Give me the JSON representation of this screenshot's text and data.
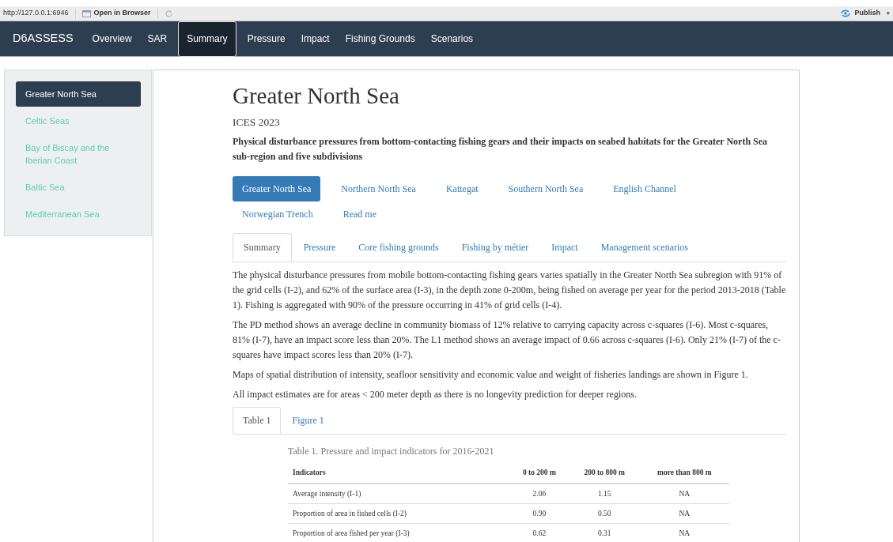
{
  "toolbar": {
    "url": "http://127.0.0.1:6946",
    "open_label": "Open in Browser",
    "publish_label": "Publish",
    "publish_caret": "▾"
  },
  "navbar": {
    "brand": "D6ASSESS",
    "items": [
      {
        "label": "Overview",
        "selected": false
      },
      {
        "label": "SAR",
        "selected": false
      },
      {
        "label": "Summary",
        "selected": true
      },
      {
        "label": "Pressure",
        "selected": false
      },
      {
        "label": "Impact",
        "selected": false
      },
      {
        "label": "Fishing Grounds",
        "selected": false
      },
      {
        "label": "Scenarios",
        "selected": false
      }
    ]
  },
  "sidebar": {
    "items": [
      {
        "label": "Greater North Sea",
        "selected": true
      },
      {
        "label": "Celtic Seas",
        "selected": false
      },
      {
        "label": "Bay of Biscay and the Iberian Coast",
        "selected": false
      },
      {
        "label": "Baltic Sea",
        "selected": false
      },
      {
        "label": "Mediterranean Sea",
        "selected": false
      }
    ]
  },
  "main": {
    "title": "Greater North Sea",
    "subtitle": "ICES 2023",
    "description": "Physical disturbance pressures from bottom-contacting fishing gears and their impacts on seabed habitats for the Greater North Sea sub-region and five subdivisions",
    "pills": [
      {
        "label": "Greater North Sea",
        "selected": true
      },
      {
        "label": "Northern North Sea",
        "selected": false
      },
      {
        "label": "Kattegat",
        "selected": false
      },
      {
        "label": "Southern North Sea",
        "selected": false
      },
      {
        "label": "English Channel",
        "selected": false
      },
      {
        "label": "Norwegian Trench",
        "selected": false
      },
      {
        "label": "Read me",
        "selected": false
      }
    ],
    "tabs": [
      {
        "label": "Summary",
        "selected": true
      },
      {
        "label": "Pressure",
        "selected": false
      },
      {
        "label": "Core fishing grounds",
        "selected": false
      },
      {
        "label": "Fishing by métier",
        "selected": false
      },
      {
        "label": "Impact",
        "selected": false
      },
      {
        "label": "Management scenarios",
        "selected": false
      }
    ],
    "paragraphs": [
      "The physical disturbance pressures from mobile bottom-contacting fishing gears varies spatially in the Greater North Sea subregion with 91% of the grid cells (I-2), and 62% of the surface area (I-3), in the depth zone 0-200m, being fished on average per year for the period 2013-2018 (Table 1). Fishing is aggregated with 90% of the pressure occurring in 41% of grid cells (I-4).",
      "The PD method shows an average decline in community biomass of 12% relative to carrying capacity across c-squares (I-6). Most c-squares, 81% (I-7), have an impact score less than 20%. The L1 method shows an average impact of 0.66 across c-squares (I-6). Only 21% (I-7) of the c-squares have impact scores less than 20% (I-7).",
      "Maps of spatial distribution of intensity, seafloor sensitivity and economic value and weight of fisheries landings are shown in Figure 1.",
      "All impact estimates are for areas < 200 meter depth as there is no longevity prediction for deeper regions."
    ],
    "subtabs": [
      {
        "label": "Table 1",
        "selected": true
      },
      {
        "label": "Figure 1",
        "selected": false
      }
    ],
    "table": {
      "caption": "Table 1. Pressure and impact indicators for 2016-2021",
      "columns": [
        "Indicators",
        "0 to 200 m",
        "200 to 800 m",
        "more than 800 m"
      ],
      "rows": [
        [
          "Average intensity (I-1)",
          "2.06",
          "1.15",
          "NA"
        ],
        [
          "Proportion of area in fished cells (I-2)",
          "0.90",
          "0.50",
          "NA"
        ],
        [
          "Proportion of area fished per year (I-3)",
          "0.62",
          "0.31",
          "NA"
        ]
      ]
    }
  }
}
